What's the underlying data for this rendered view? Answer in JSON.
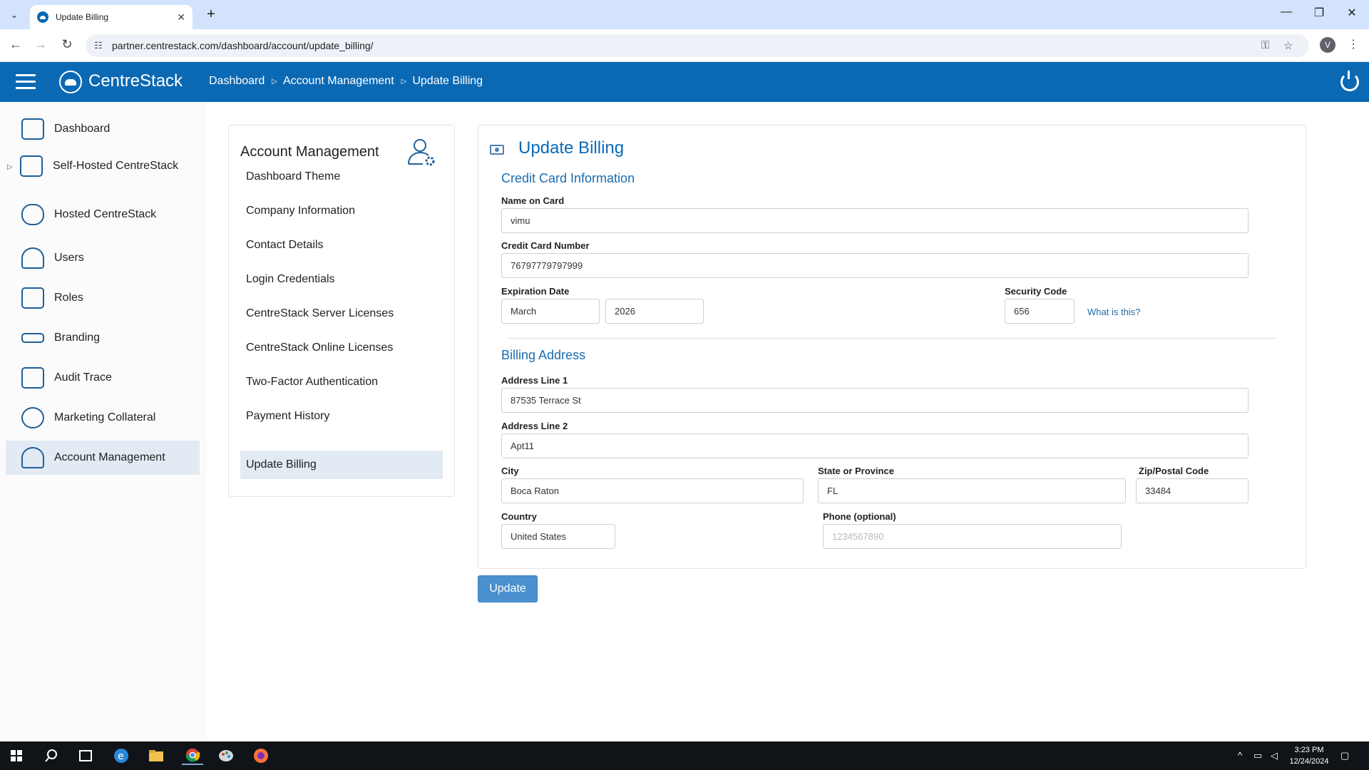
{
  "browser": {
    "tab_title": "Update Billing",
    "url": "partner.centrestack.com/dashboard/account/update_billing/",
    "profile_initial": "V"
  },
  "header": {
    "brand": "CentreStack",
    "breadcrumbs": [
      "Dashboard",
      "Account Management",
      "Update Billing"
    ]
  },
  "sidebar": {
    "items": [
      {
        "label": "Dashboard",
        "icon": "dashboard-grid-icon"
      },
      {
        "label": "Self-Hosted CentreStack",
        "icon": "self-hosted-icon"
      },
      {
        "label": "Hosted CentreStack",
        "icon": "hosted-cloud-icon"
      },
      {
        "label": "Users",
        "icon": "users-icon"
      },
      {
        "label": "Roles",
        "icon": "roles-icon"
      },
      {
        "label": "Branding",
        "icon": "branding-icon"
      },
      {
        "label": "Audit Trace",
        "icon": "audit-trace-icon"
      },
      {
        "label": "Marketing Collateral",
        "icon": "marketing-target-icon"
      },
      {
        "label": "Account Management",
        "icon": "account-management-icon"
      }
    ]
  },
  "account_menu": {
    "title": "Account Management",
    "items": [
      "Dashboard Theme",
      "Company Information",
      "Contact Details",
      "Login Credentials",
      "CentreStack Server Licenses",
      "CentreStack Online Licenses",
      "Two-Factor Authentication",
      "Payment History",
      "Update Billing"
    ]
  },
  "billing": {
    "title": "Update Billing",
    "credit_card_section": "Credit Card Information",
    "name_on_card_label": "Name on Card",
    "name_on_card": "vimu",
    "card_number_label": "Credit Card Number",
    "card_number": "76797779797999",
    "expiration_label": "Expiration Date",
    "exp_month": "March",
    "exp_year": "2026",
    "security_code_label": "Security Code",
    "security_code": "656",
    "what_is_this": "What is this?",
    "billing_address_section": "Billing Address",
    "address1_label": "Address Line 1",
    "address1": "87535 Terrace St",
    "address2_label": "Address Line 2",
    "address2": "Apt11",
    "city_label": "City",
    "city": "Boca Raton",
    "state_label": "State or Province",
    "state": "FL",
    "zip_label": "Zip/Postal Code",
    "zip": "33484",
    "country_label": "Country",
    "country": "United States",
    "phone_label": "Phone (optional)",
    "phone_placeholder": "1234567890",
    "update_button": "Update"
  },
  "taskbar": {
    "time": "3:23 PM",
    "date": "12/24/2024"
  }
}
